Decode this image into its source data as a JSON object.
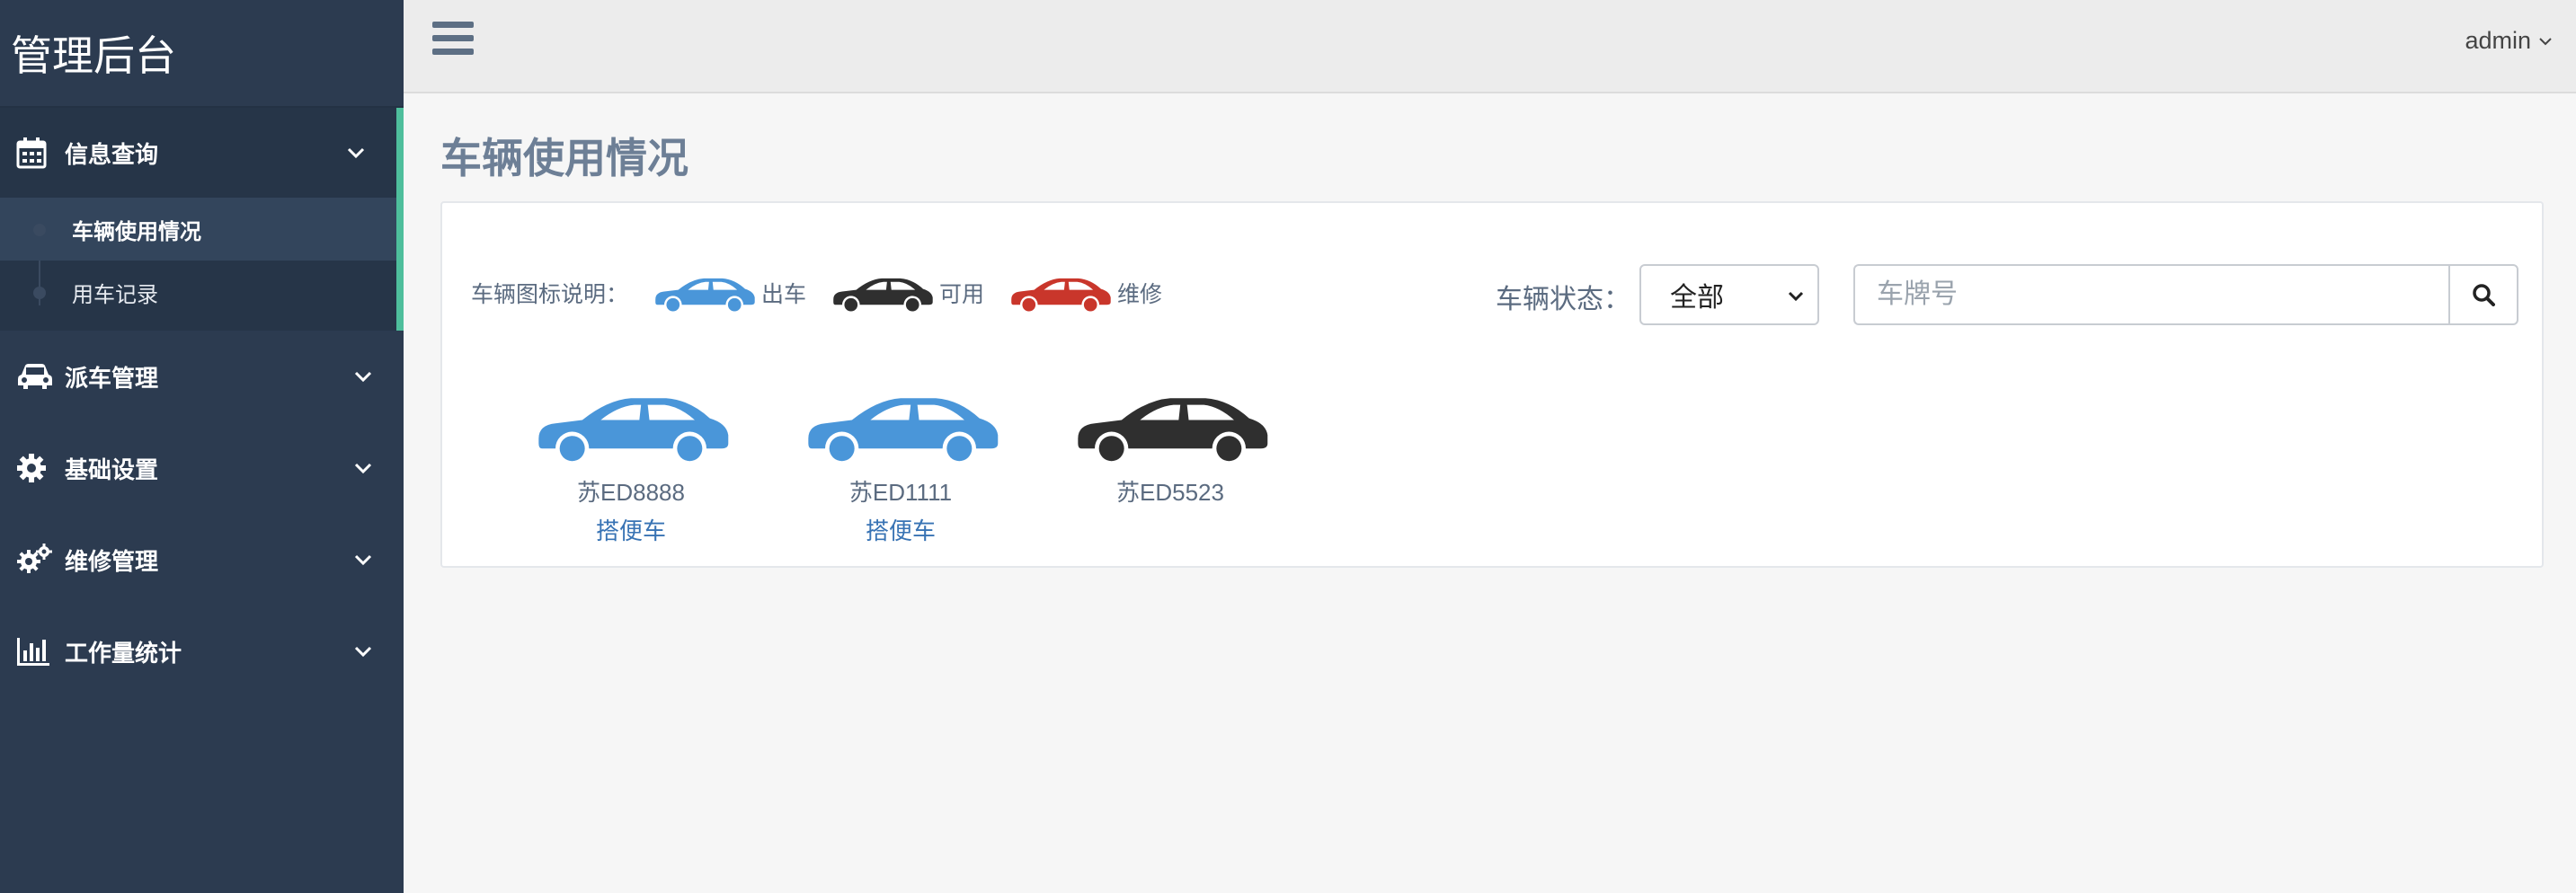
{
  "brand": "管理后台",
  "colors": {
    "in_use": "#4a96d9",
    "available": "#2f2f2f",
    "repair": "#c9362b",
    "accent": "#4ebe9c",
    "sidebar": "#2c3b50"
  },
  "sidebar": {
    "groups": [
      {
        "label": "信息查询",
        "icon": "calendar-icon",
        "expanded": true,
        "items": [
          {
            "label": "车辆使用情况",
            "active": true
          },
          {
            "label": "用车记录",
            "active": false
          }
        ]
      },
      {
        "label": "派车管理",
        "icon": "car-icon"
      },
      {
        "label": "基础设置",
        "icon": "gear-icon"
      },
      {
        "label": "维修管理",
        "icon": "gears-icon"
      },
      {
        "label": "工作量统计",
        "icon": "bar-chart-icon"
      }
    ]
  },
  "header": {
    "user": "admin"
  },
  "page": {
    "title": "车辆使用情况"
  },
  "legend": {
    "label": "车辆图标说明：",
    "in_use": "出车",
    "available": "可用",
    "repair": "维修"
  },
  "filter": {
    "status_label": "车辆状态：",
    "status_value": "全部",
    "search_placeholder": "车牌号"
  },
  "vehicles": [
    {
      "plate": "苏ED8888",
      "note": "搭便车",
      "status": "in_use"
    },
    {
      "plate": "苏ED1111",
      "note": "搭便车",
      "status": "in_use"
    },
    {
      "plate": "苏ED5523",
      "note": "",
      "status": "available"
    }
  ]
}
